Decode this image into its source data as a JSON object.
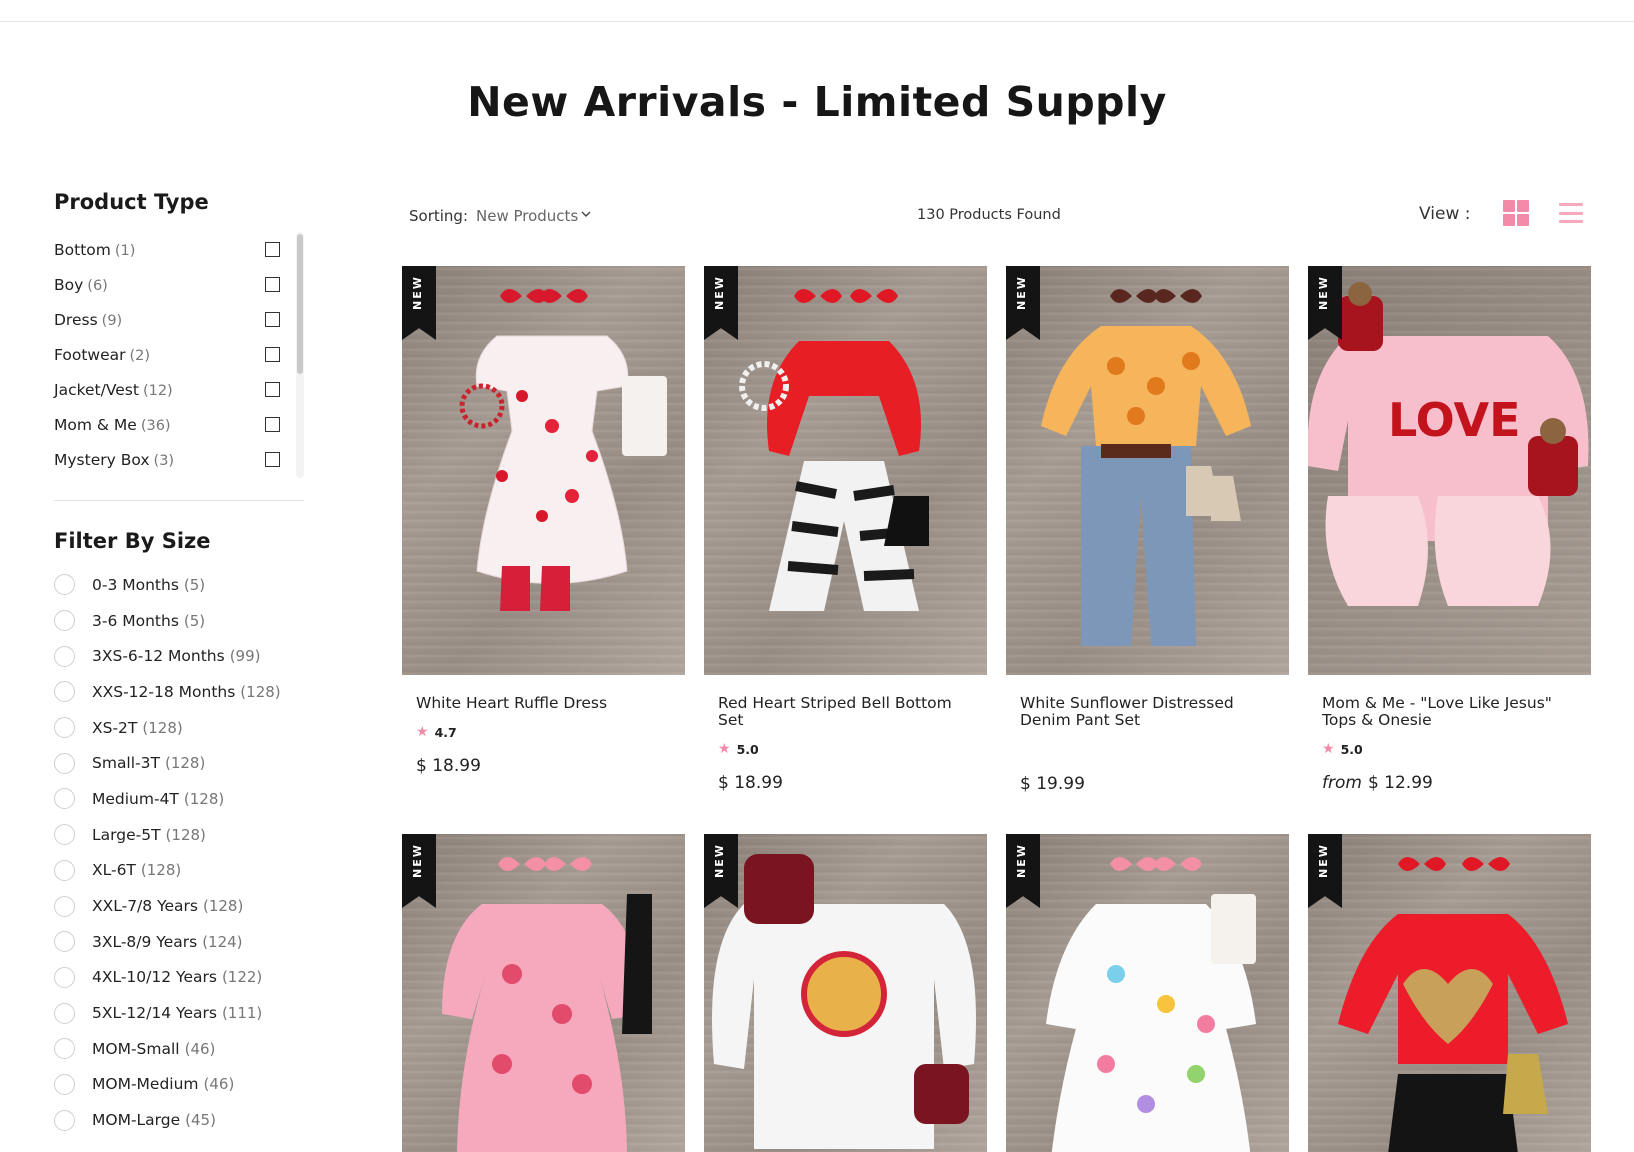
{
  "page": {
    "title": "New Arrivals - Limited Supply"
  },
  "sidebar": {
    "product_type": {
      "title": "Product Type",
      "items": [
        {
          "label": "Bottom",
          "count": "(1)"
        },
        {
          "label": "Boy",
          "count": "(6)"
        },
        {
          "label": "Dress",
          "count": "(9)"
        },
        {
          "label": "Footwear",
          "count": "(2)"
        },
        {
          "label": "Jacket/Vest",
          "count": "(12)"
        },
        {
          "label": "Mom & Me",
          "count": "(36)"
        },
        {
          "label": "Mystery Box",
          "count": "(3)"
        }
      ]
    },
    "size": {
      "title": "Filter By Size",
      "items": [
        {
          "label": "0-3 Months",
          "count": "(5)"
        },
        {
          "label": "3-6 Months",
          "count": "(5)"
        },
        {
          "label": "3XS-6-12 Months",
          "count": "(99)"
        },
        {
          "label": "XXS-12-18 Months",
          "count": "(128)"
        },
        {
          "label": "XS-2T",
          "count": "(128)"
        },
        {
          "label": "Small-3T",
          "count": "(128)"
        },
        {
          "label": "Medium-4T",
          "count": "(128)"
        },
        {
          "label": "Large-5T",
          "count": "(128)"
        },
        {
          "label": "XL-6T",
          "count": "(128)"
        },
        {
          "label": "XXL-7/8 Years",
          "count": "(128)"
        },
        {
          "label": "3XL-8/9 Years",
          "count": "(124)"
        },
        {
          "label": "4XL-10/12 Years",
          "count": "(122)"
        },
        {
          "label": "5XL-12/14 Years",
          "count": "(111)"
        },
        {
          "label": "MOM-Small",
          "count": "(46)"
        },
        {
          "label": "MOM-Medium",
          "count": "(46)"
        },
        {
          "label": "MOM-Large",
          "count": "(45)"
        }
      ]
    }
  },
  "toolbar": {
    "sorting_label": "Sorting:",
    "sorting_value": "New Products",
    "found": "130 Products Found",
    "view_label": "View :"
  },
  "badge": "NEW",
  "products": [
    {
      "name": "White Heart Ruffle Dress",
      "rating": "4.7",
      "price": "$ 18.99",
      "from": ""
    },
    {
      "name": "Red Heart Striped Bell Bottom Set",
      "rating": "5.0",
      "price": "$ 18.99",
      "from": ""
    },
    {
      "name": "White Sunflower Distressed Denim Pant Set",
      "rating": "",
      "price": "$ 19.99",
      "from": ""
    },
    {
      "name": "Mom & Me - \"Love Like Jesus\" Tops & Onesie",
      "rating": "5.0",
      "price": "$ 12.99",
      "from": "from"
    }
  ],
  "colors": {
    "accent_pink": "#f28ba8",
    "text_dark": "#1f1f1f",
    "badge_black": "#141414"
  },
  "icons": {
    "grid_view": "grid-view-icon",
    "list_view": "list-view-icon",
    "sort_chevron": "chevron-down-icon",
    "rating_star": "star-icon"
  }
}
